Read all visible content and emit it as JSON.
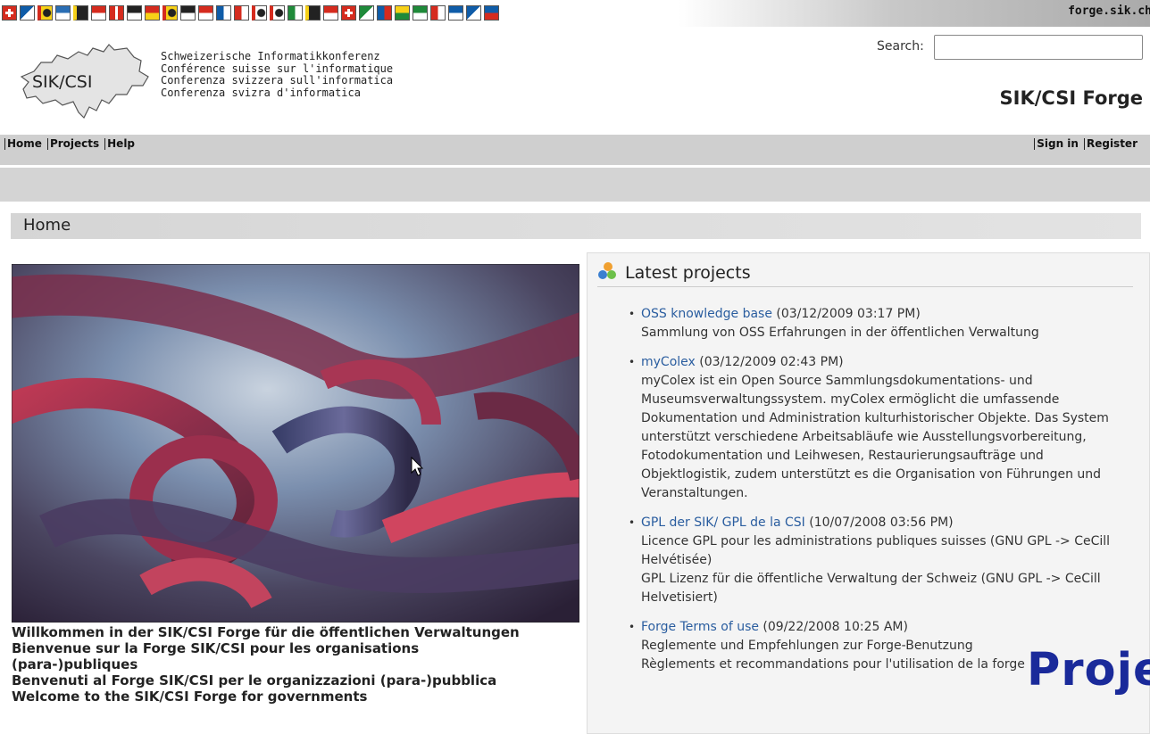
{
  "top": {
    "site_domain": "forge.sik.ch",
    "flags": [
      {
        "name": "switzerland",
        "c1": "#d52b1e",
        "c2": "#ffffff",
        "pattern": "cross"
      },
      {
        "name": "zurich",
        "c1": "#0f5ca8",
        "c2": "#ffffff",
        "pattern": "diag"
      },
      {
        "name": "bern",
        "c1": "#d52b1e",
        "c2": "#f7d117",
        "pattern": "bear"
      },
      {
        "name": "lucerne",
        "c1": "#2a6eb4",
        "c2": "#ffffff",
        "pattern": "hsplit"
      },
      {
        "name": "uri",
        "c1": "#f7d117",
        "c2": "#222222",
        "pattern": "bull"
      },
      {
        "name": "schwyz",
        "c1": "#d52b1e",
        "c2": "#ffffff",
        "pattern": "solid"
      },
      {
        "name": "obwalden",
        "c1": "#d52b1e",
        "c2": "#ffffff",
        "pattern": "key"
      },
      {
        "name": "nidwalden",
        "c1": "#222222",
        "c2": "#ffffff",
        "pattern": "hsplit"
      },
      {
        "name": "glarus",
        "c1": "#d52b1e",
        "c2": "#f7d117",
        "pattern": "solid"
      },
      {
        "name": "zug",
        "c1": "#d52b1e",
        "c2": "#f7d117",
        "pattern": "bull"
      },
      {
        "name": "fribourg",
        "c1": "#222222",
        "c2": "#ffffff",
        "pattern": "hsplit"
      },
      {
        "name": "solothurn",
        "c1": "#d52b1e",
        "c2": "#ffffff",
        "pattern": "hsplit"
      },
      {
        "name": "basel-stadt",
        "c1": "#0f5ca8",
        "c2": "#ffffff",
        "pattern": "vsplit"
      },
      {
        "name": "basel-land",
        "c1": "#d52b1e",
        "c2": "#ffffff",
        "pattern": "vsplit"
      },
      {
        "name": "schaffhausen",
        "c1": "#d52b1e",
        "c2": "#ffffff",
        "pattern": "bear"
      },
      {
        "name": "appenzell-ar",
        "c1": "#d52b1e",
        "c2": "#ffffff",
        "pattern": "bear"
      },
      {
        "name": "appenzell-ir",
        "c1": "#1f8a3a",
        "c2": "#ffffff",
        "pattern": "vsplit"
      },
      {
        "name": "st-gallen",
        "c1": "#f7d117",
        "c2": "#222222",
        "pattern": "bull"
      },
      {
        "name": "graubuenden",
        "c1": "#d52b1e",
        "c2": "#ffffff",
        "pattern": "hsplit"
      },
      {
        "name": "aargau",
        "c1": "#d52b1e",
        "c2": "#ffffff",
        "pattern": "cross"
      },
      {
        "name": "thurgau",
        "c1": "#1f8a3a",
        "c2": "#ffffff",
        "pattern": "diag"
      },
      {
        "name": "ticino",
        "c1": "#0f5ca8",
        "c2": "#d52b1e",
        "pattern": "vsplit"
      },
      {
        "name": "vaud",
        "c1": "#f7d117",
        "c2": "#1f8a3a",
        "pattern": "hsplit"
      },
      {
        "name": "valais",
        "c1": "#1f8a3a",
        "c2": "#ffffff",
        "pattern": "hsplit"
      },
      {
        "name": "neuchatel",
        "c1": "#d52b1e",
        "c2": "#ffffff",
        "pattern": "vsplit"
      },
      {
        "name": "geneva",
        "c1": "#0f5ca8",
        "c2": "#ffffff",
        "pattern": "hsplit"
      },
      {
        "name": "jura",
        "c1": "#0f5ca8",
        "c2": "#ffffff",
        "pattern": "diag"
      },
      {
        "name": "liechtenstein",
        "c1": "#0f5ca8",
        "c2": "#d52b1e",
        "pattern": "hsplit"
      }
    ]
  },
  "header": {
    "logo_text": "SIK/CSI",
    "taglines": [
      "Schweizerische Informatikkonferenz",
      "Conférence suisse sur l'informatique",
      "Conferenza svizzera sull'informatica",
      "Conferenza svizra d'informatica"
    ],
    "search_label": "Search:",
    "search_value": "",
    "site_title": "SIK/CSI Forge"
  },
  "nav": {
    "left": [
      "Home",
      "Projects",
      "Help"
    ],
    "right": [
      "Sign in",
      "Register"
    ]
  },
  "page": {
    "title": "Home"
  },
  "welcome": [
    "Willkommen in der SIK/CSI Forge für die öffentlichen Verwaltungen",
    "Bienvenue sur la Forge SIK/CSI pour les organisations",
    "(para-)publiques",
    "Benvenuti al Forge SIK/CSI per le organizzazioni (para-)pubblica",
    "Welcome to the SIK/CSI Forge for governments"
  ],
  "latest": {
    "title": "Latest projects",
    "items": [
      {
        "name": "OSS knowledge base",
        "date": " (03/12/2009 03:17 PM)",
        "desc": "Sammlung von OSS Erfahrungen in der öffentlichen Verwaltung"
      },
      {
        "name": "myColex",
        "date": " (03/12/2009 02:43 PM)",
        "desc": "myColex ist ein Open Source Sammlungsdokumentations- und Museumsverwaltungssystem. myColex ermöglicht die umfassende Dokumentation und Administration kulturhistorischer Objekte. Das System unterstützt verschiedene Arbeitsabläufe wie Ausstellungsvorbereitung, Fotodokumentation und Leihwesen, Restaurierungsaufträge und Objektlogistik, zudem unterstützt es die Organisation von Führungen und Veranstaltungen."
      },
      {
        "name": "GPL der SIK/ GPL de la CSI",
        "date": " (10/07/2008 03:56 PM)",
        "desc": "Licence GPL pour les administrations publiques suisses (GNU GPL -> CeCill Helvétisée)\nGPL Lizenz für die öffentliche Verwaltung der Schweiz (GNU GPL -> CeCill Helvetisiert)"
      },
      {
        "name": "Forge Terms of use",
        "date": " (09/22/2008 10:25 AM)",
        "desc": "Reglemente und Empfehlungen zur Forge-Benutzung\nRèglements et recommandations pour l'utilisation de la forge"
      }
    ]
  },
  "overlay_text": "Proje",
  "colors": {
    "nav_bg": "#cfcfcf",
    "link": "#2a5d9f",
    "panel_bg": "#f4f4f4",
    "overlay": "#1a2a9a"
  }
}
